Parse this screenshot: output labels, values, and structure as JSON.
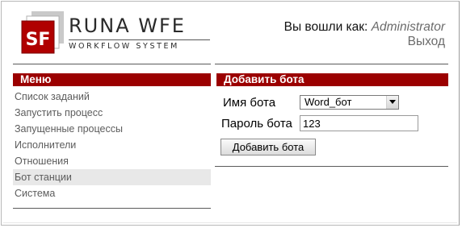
{
  "logo": {
    "mark_text": "SF",
    "title": "RUNA WFE",
    "subtitle": "WORKFLOW SYSTEM"
  },
  "header": {
    "logged_in_label": "Вы вошли как:",
    "username": "Administrator",
    "logout_label": "Выход"
  },
  "menu": {
    "title": "Меню",
    "active_index": 5,
    "items": [
      {
        "label": "Список заданий"
      },
      {
        "label": "Запустить процесс"
      },
      {
        "label": "Запущенные процессы"
      },
      {
        "label": "Исполнители"
      },
      {
        "label": "Отношения"
      },
      {
        "label": "Бот станции"
      },
      {
        "label": "Система"
      }
    ]
  },
  "panel": {
    "title": "Добавить бота",
    "bot_name_label": "Имя бота",
    "bot_name_value": "Word_бот",
    "password_label": "Пароль бота",
    "password_value": "123",
    "submit_label": "Добавить бота"
  },
  "colors": {
    "accent": "#9b0000",
    "active_row": "#e8e8e8",
    "muted_text": "#6b6b6b"
  }
}
